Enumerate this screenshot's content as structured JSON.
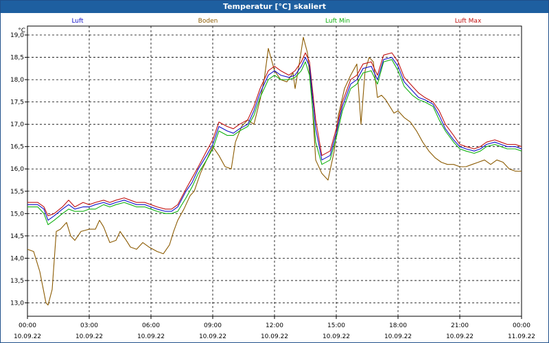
{
  "window": {
    "title": "Temperatur [°C] skaliert"
  },
  "colors": {
    "title_bar": "#1e5fa0",
    "luft": "#1010c8",
    "boden": "#8b5a00",
    "luft_min": "#10b010",
    "luft_max": "#c01010",
    "grid": "#000000"
  },
  "chart_data": {
    "type": "line",
    "title": "Temperatur [°C] skaliert",
    "ylabel": "°C",
    "xlabel": "",
    "ylim": [
      12.7,
      19.2
    ],
    "xlim": [
      0,
      24
    ],
    "grid": true,
    "legend_position": "top",
    "y_ticks": [
      "13,0",
      "13,5",
      "14,0",
      "14,5",
      "15,0",
      "15,5",
      "16,0",
      "16,5",
      "17,0",
      "17,5",
      "18,0",
      "18,5",
      "19,0"
    ],
    "y_tick_values": [
      13.0,
      13.5,
      14.0,
      14.5,
      15.0,
      15.5,
      16.0,
      16.5,
      17.0,
      17.5,
      18.0,
      18.5,
      19.0
    ],
    "x_ticks": [
      {
        "time": "00:00",
        "date": "10.09.22",
        "hour": 0
      },
      {
        "time": "03:00",
        "date": "10.09.22",
        "hour": 3
      },
      {
        "time": "06:00",
        "date": "10.09.22",
        "hour": 6
      },
      {
        "time": "09:00",
        "date": "10.09.22",
        "hour": 9
      },
      {
        "time": "12:00",
        "date": "10.09.22",
        "hour": 12
      },
      {
        "time": "15:00",
        "date": "10.09.22",
        "hour": 15
      },
      {
        "time": "18:00",
        "date": "10.09.22",
        "hour": 18
      },
      {
        "time": "21:00",
        "date": "10.09.22",
        "hour": 21
      },
      {
        "time": "00:00",
        "date": "11.09.22",
        "hour": 24
      }
    ],
    "series": [
      {
        "name": "Luft",
        "color": "#1010c8",
        "x": [
          0,
          0.5,
          0.8,
          1.0,
          1.3,
          1.7,
          2.0,
          2.3,
          2.7,
          3.0,
          3.3,
          3.7,
          4.0,
          4.3,
          4.7,
          5.0,
          5.3,
          5.7,
          6.0,
          6.3,
          6.7,
          7.0,
          7.3,
          7.7,
          8.0,
          8.3,
          8.7,
          9.0,
          9.3,
          9.7,
          10.0,
          10.3,
          10.7,
          11.0,
          11.3,
          11.7,
          12.0,
          12.3,
          12.7,
          13.0,
          13.3,
          13.5,
          13.7,
          14.0,
          14.3,
          14.7,
          15.0,
          15.3,
          15.7,
          16.0,
          16.3,
          16.7,
          17.0,
          17.3,
          17.7,
          18.0,
          18.3,
          18.7,
          19.0,
          19.3,
          19.7,
          20.0,
          20.3,
          20.7,
          21.0,
          21.3,
          21.7,
          22.0,
          22.3,
          22.7,
          23.0,
          23.3,
          23.7,
          24.0
        ],
        "values": [
          15.2,
          15.2,
          15.1,
          14.85,
          14.95,
          15.1,
          15.2,
          15.1,
          15.15,
          15.15,
          15.2,
          15.25,
          15.2,
          15.25,
          15.3,
          15.25,
          15.2,
          15.2,
          15.15,
          15.1,
          15.05,
          15.05,
          15.15,
          15.5,
          15.7,
          16.0,
          16.3,
          16.55,
          16.95,
          16.85,
          16.8,
          16.9,
          17.0,
          17.3,
          17.7,
          18.1,
          18.2,
          18.1,
          18.05,
          18.1,
          18.3,
          18.5,
          18.3,
          16.9,
          16.2,
          16.3,
          16.8,
          17.4,
          17.9,
          18.0,
          18.25,
          18.3,
          18.0,
          18.45,
          18.5,
          18.3,
          17.95,
          17.75,
          17.6,
          17.55,
          17.45,
          17.2,
          16.9,
          16.65,
          16.5,
          16.45,
          16.4,
          16.45,
          16.55,
          16.6,
          16.55,
          16.5,
          16.5,
          16.45
        ]
      },
      {
        "name": "Boden",
        "color": "#8b5a00",
        "x": [
          0,
          0.3,
          0.6,
          0.9,
          1.0,
          1.2,
          1.4,
          1.6,
          1.9,
          2.1,
          2.3,
          2.6,
          3.0,
          3.3,
          3.5,
          3.7,
          4.0,
          4.3,
          4.5,
          4.8,
          5.0,
          5.3,
          5.6,
          5.9,
          6.1,
          6.3,
          6.6,
          6.9,
          7.1,
          7.3,
          7.6,
          7.9,
          8.1,
          8.4,
          8.7,
          9.0,
          9.3,
          9.6,
          9.9,
          10.1,
          10.4,
          10.7,
          11.0,
          11.3,
          11.5,
          11.7,
          12.0,
          12.3,
          12.6,
          12.9,
          13.0,
          13.2,
          13.4,
          13.6,
          13.8,
          14.0,
          14.3,
          14.6,
          14.9,
          15.1,
          15.4,
          15.7,
          16.0,
          16.2,
          16.4,
          16.6,
          16.8,
          17.0,
          17.2,
          17.4,
          17.6,
          17.8,
          18.0,
          18.3,
          18.6,
          18.9,
          19.2,
          19.5,
          19.8,
          20.1,
          20.4,
          20.7,
          21.0,
          21.3,
          21.6,
          21.9,
          22.2,
          22.5,
          22.8,
          23.1,
          23.4,
          23.7,
          24.0
        ],
        "values": [
          14.2,
          14.15,
          13.7,
          13.0,
          12.95,
          13.3,
          14.6,
          14.65,
          14.8,
          14.5,
          14.4,
          14.6,
          14.65,
          14.65,
          14.85,
          14.7,
          14.35,
          14.4,
          14.6,
          14.4,
          14.25,
          14.2,
          14.35,
          14.25,
          14.2,
          14.15,
          14.1,
          14.3,
          14.6,
          14.85,
          15.1,
          15.4,
          15.5,
          15.9,
          16.2,
          16.5,
          16.3,
          16.05,
          16.0,
          16.6,
          16.95,
          17.1,
          17.0,
          17.55,
          18.0,
          18.7,
          18.2,
          18.0,
          17.95,
          18.15,
          17.8,
          18.35,
          18.95,
          18.6,
          17.7,
          16.2,
          15.9,
          15.75,
          16.4,
          17.2,
          17.8,
          18.1,
          18.35,
          17.0,
          18.2,
          18.5,
          18.4,
          17.6,
          17.65,
          17.55,
          17.4,
          17.25,
          17.3,
          17.15,
          17.05,
          16.85,
          16.6,
          16.4,
          16.25,
          16.15,
          16.1,
          16.1,
          16.05,
          16.05,
          16.1,
          16.15,
          16.2,
          16.1,
          16.2,
          16.15,
          16.0,
          15.95,
          15.95
        ]
      },
      {
        "name": "Luft Min",
        "color": "#10b010",
        "x": [
          0,
          0.5,
          0.8,
          1.0,
          1.3,
          1.7,
          2.0,
          2.3,
          2.7,
          3.0,
          3.3,
          3.7,
          4.0,
          4.3,
          4.7,
          5.0,
          5.3,
          5.7,
          6.0,
          6.3,
          6.7,
          7.0,
          7.3,
          7.7,
          8.0,
          8.3,
          8.7,
          9.0,
          9.3,
          9.7,
          10.0,
          10.3,
          10.7,
          11.0,
          11.3,
          11.7,
          12.0,
          12.3,
          12.7,
          13.0,
          13.3,
          13.5,
          13.7,
          14.0,
          14.3,
          14.7,
          15.0,
          15.3,
          15.7,
          16.0,
          16.3,
          16.7,
          17.0,
          17.3,
          17.7,
          18.0,
          18.3,
          18.7,
          19.0,
          19.3,
          19.7,
          20.0,
          20.3,
          20.7,
          21.0,
          21.3,
          21.7,
          22.0,
          22.3,
          22.7,
          23.0,
          23.3,
          23.7,
          24.0
        ],
        "values": [
          15.15,
          15.15,
          15.0,
          14.75,
          14.85,
          15.0,
          15.1,
          15.05,
          15.05,
          15.1,
          15.1,
          15.2,
          15.15,
          15.2,
          15.25,
          15.2,
          15.15,
          15.15,
          15.1,
          15.05,
          15.0,
          15.0,
          15.05,
          15.35,
          15.6,
          15.9,
          16.2,
          16.45,
          16.85,
          16.75,
          16.75,
          16.85,
          16.95,
          17.2,
          17.6,
          18.0,
          18.1,
          18.0,
          18.0,
          18.05,
          18.2,
          18.4,
          18.1,
          16.6,
          16.1,
          16.2,
          16.7,
          17.3,
          17.8,
          17.9,
          18.15,
          18.2,
          17.9,
          18.4,
          18.45,
          18.2,
          17.85,
          17.65,
          17.55,
          17.5,
          17.4,
          17.1,
          16.85,
          16.6,
          16.45,
          16.4,
          16.35,
          16.4,
          16.5,
          16.55,
          16.5,
          16.45,
          16.45,
          16.4
        ]
      },
      {
        "name": "Luft Max",
        "color": "#c01010",
        "x": [
          0,
          0.5,
          0.8,
          1.0,
          1.3,
          1.7,
          2.0,
          2.3,
          2.7,
          3.0,
          3.3,
          3.7,
          4.0,
          4.3,
          4.7,
          5.0,
          5.3,
          5.7,
          6.0,
          6.3,
          6.7,
          7.0,
          7.3,
          7.7,
          8.0,
          8.3,
          8.7,
          9.0,
          9.3,
          9.7,
          10.0,
          10.3,
          10.7,
          11.0,
          11.3,
          11.7,
          12.0,
          12.3,
          12.7,
          13.0,
          13.3,
          13.5,
          13.7,
          14.0,
          14.3,
          14.7,
          15.0,
          15.3,
          15.7,
          16.0,
          16.3,
          16.7,
          17.0,
          17.3,
          17.7,
          18.0,
          18.3,
          18.7,
          19.0,
          19.3,
          19.7,
          20.0,
          20.3,
          20.7,
          21.0,
          21.3,
          21.7,
          22.0,
          22.3,
          22.7,
          23.0,
          23.3,
          23.7,
          24.0
        ],
        "values": [
          15.25,
          15.25,
          15.15,
          14.95,
          15.0,
          15.15,
          15.3,
          15.15,
          15.25,
          15.2,
          15.25,
          15.3,
          15.25,
          15.3,
          15.35,
          15.3,
          15.25,
          15.25,
          15.2,
          15.15,
          15.1,
          15.1,
          15.2,
          15.55,
          15.8,
          16.05,
          16.4,
          16.65,
          17.05,
          16.95,
          16.9,
          17.0,
          17.1,
          17.4,
          17.8,
          18.2,
          18.3,
          18.2,
          18.1,
          18.2,
          18.4,
          18.6,
          18.4,
          17.1,
          16.3,
          16.4,
          16.9,
          17.5,
          18.0,
          18.1,
          18.35,
          18.4,
          18.1,
          18.55,
          18.6,
          18.4,
          18.05,
          17.85,
          17.7,
          17.6,
          17.5,
          17.3,
          17.0,
          16.75,
          16.55,
          16.5,
          16.45,
          16.5,
          16.6,
          16.65,
          16.6,
          16.55,
          16.55,
          16.5
        ]
      }
    ]
  }
}
